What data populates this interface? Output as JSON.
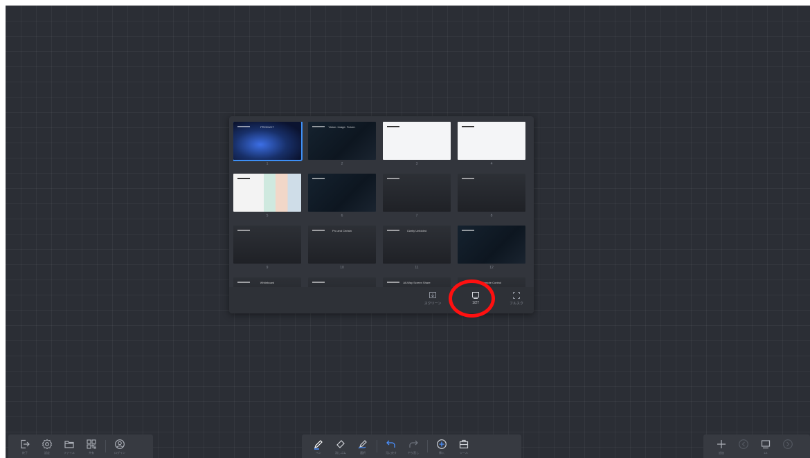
{
  "panel": {
    "thumbnails": [
      {
        "num": "1",
        "style": "t-blue",
        "selected": true,
        "caption": "PRODUCT"
      },
      {
        "num": "2",
        "style": "t-dark",
        "selected": false,
        "caption": "Vision. Image. Future."
      },
      {
        "num": "3",
        "style": "t-white",
        "selected": false,
        "caption": ""
      },
      {
        "num": "4",
        "style": "t-white",
        "selected": false,
        "caption": ""
      },
      {
        "num": "5",
        "style": "t-pastel",
        "selected": false,
        "caption": ""
      },
      {
        "num": "6",
        "style": "t-dark",
        "selected": false,
        "caption": ""
      },
      {
        "num": "7",
        "style": "t-gray",
        "selected": false,
        "caption": ""
      },
      {
        "num": "8",
        "style": "t-gray",
        "selected": false,
        "caption": ""
      },
      {
        "num": "9",
        "style": "t-gray",
        "selected": false,
        "caption": ""
      },
      {
        "num": "10",
        "style": "t-gray",
        "selected": false,
        "caption": "Pro and Certain"
      },
      {
        "num": "11",
        "style": "t-gray",
        "selected": false,
        "caption": "Clarity Unfolded"
      },
      {
        "num": "12",
        "style": "t-dark",
        "selected": false,
        "caption": ""
      },
      {
        "num": "",
        "style": "t-gray",
        "selected": false,
        "caption": "Whiteboard"
      },
      {
        "num": "",
        "style": "t-gray",
        "selected": false,
        "caption": ""
      },
      {
        "num": "",
        "style": "t-gray",
        "selected": false,
        "caption": "All-Way Screen Share"
      },
      {
        "num": "",
        "style": "t-gray",
        "selected": false,
        "caption": "Remote Control"
      }
    ],
    "footer": {
      "screen_label": "スクリーン",
      "page_counter": "1/27",
      "fullscreen_label": "フルスク"
    }
  },
  "left_toolbar": {
    "exit_label": "終了",
    "settings_label": "設定",
    "files_label": "ファイル",
    "apps_label": "共有",
    "account_label": "ログイン"
  },
  "center_toolbar": {
    "pen_label": "ペン",
    "eraser_label": "消しゴム",
    "select_label": "選択",
    "undo_label": "元に戻す",
    "redo_label": "やり直し",
    "insert_label": "挿入",
    "tools_label": "ツール"
  },
  "right_toolbar": {
    "add_label": "追加",
    "prev_label": "",
    "pages_label": "1/1",
    "next_label": ""
  }
}
